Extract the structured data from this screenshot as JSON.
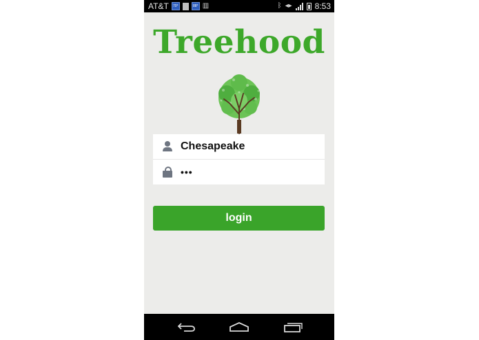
{
  "status_bar": {
    "carrier": "AT&T",
    "notif_1": "70°",
    "notif_2": "88°",
    "time": "8:53",
    "icons": [
      "weather-icon",
      "sim-icon",
      "weather-icon",
      "barcode-icon",
      "bluetooth-icon",
      "vibrate-icon",
      "signal-icon",
      "battery-icon"
    ]
  },
  "app": {
    "title": "Treehood",
    "brand_color": "#3da82a",
    "logo": "tree-icon"
  },
  "form": {
    "username_value": "Chesapeake",
    "password_value": "•••",
    "username_icon": "user-icon",
    "password_icon": "lock-icon"
  },
  "login_button": {
    "label": "login",
    "color": "#3aa42a"
  },
  "nav_bar": {
    "buttons": [
      "back-icon",
      "home-icon",
      "recent-apps-icon"
    ]
  }
}
